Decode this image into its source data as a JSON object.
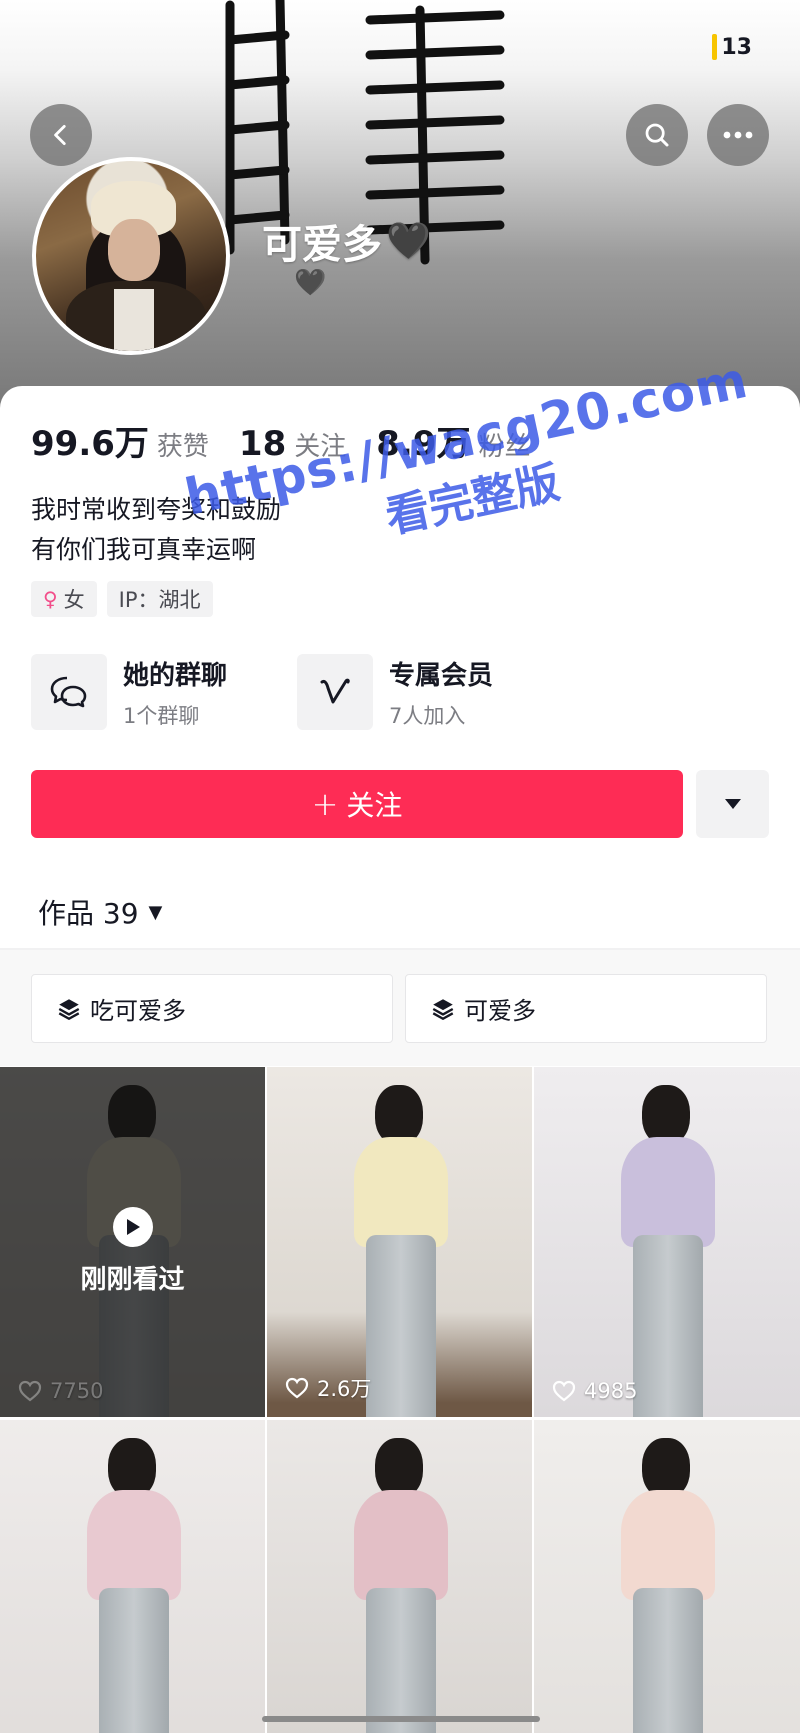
{
  "status": {
    "battery": "13"
  },
  "header": {
    "back_icon": "chevron-left-icon",
    "search_icon": "search-icon",
    "more_icon": "more-horizontal-icon"
  },
  "profile": {
    "nickname": "可爱多",
    "nickname_heart": "🖤",
    "sub_hearts": "🖤",
    "stats": [
      {
        "value": "99.6万",
        "label": "获赞"
      },
      {
        "value": "18",
        "label": "关注"
      },
      {
        "value": "8.9万",
        "label": "粉丝"
      }
    ],
    "bio_line1": "我时常收到夸奖和鼓励",
    "bio_line2": "有你们我可真幸运啊",
    "tags": {
      "gender": "女",
      "ip": "IP：湖北"
    }
  },
  "features": [
    {
      "title": "她的群聊",
      "subtitle": "1个群聊",
      "icon": "group-chat-icon"
    },
    {
      "title": "专属会员",
      "subtitle": "7人加入",
      "icon": "membership-v-icon"
    }
  ],
  "actions": {
    "follow_label": "关注",
    "follow_plus": "+"
  },
  "works": {
    "label": "作品 39"
  },
  "collections": [
    {
      "label": "吃可爱多",
      "icon": "collection-layers-icon"
    },
    {
      "label": "可爱多",
      "icon": "collection-layers-icon"
    }
  ],
  "videos": [
    {
      "likes": "7750",
      "watched_label": "刚刚看过"
    },
    {
      "likes": "2.6万"
    },
    {
      "likes": "4985"
    },
    {
      "likes": ""
    },
    {
      "likes": ""
    },
    {
      "likes": ""
    }
  ],
  "watermark": {
    "line1": "https://wacg20.com",
    "line2": "看完整版"
  },
  "colors": {
    "accent": "#fe2c55",
    "watermark": "#3c5ae6"
  }
}
